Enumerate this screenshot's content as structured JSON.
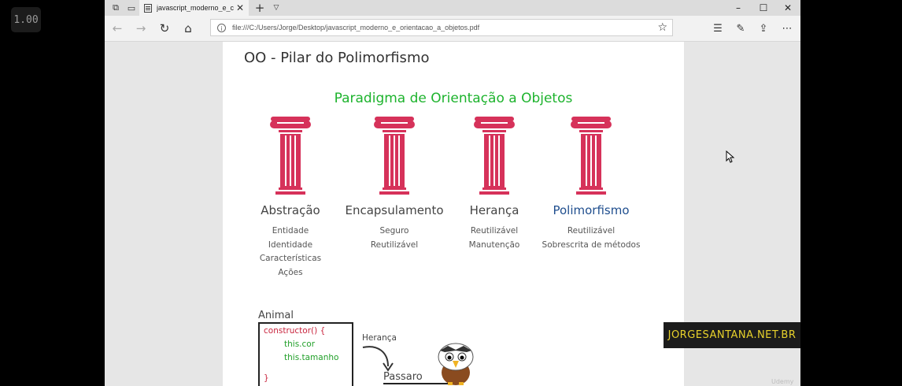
{
  "speed_badge": "1.00",
  "browser": {
    "tab_title": "javascript_moderno_e_c",
    "url": "file:///C:/Users/Jorge/Desktop/javascript_moderno_e_orientacao_a_objetos.pdf"
  },
  "slide": {
    "title": "OO - Pilar do Polimorfismo",
    "subtitle": "Paradigma de Orientação a Objetos",
    "pillars": [
      {
        "label": "Abstração",
        "lines": [
          "Entidade",
          "Identidade",
          "Características",
          "Ações"
        ]
      },
      {
        "label": "Encapsulamento",
        "lines": [
          "Seguro",
          "Reutilizável"
        ]
      },
      {
        "label": "Herança",
        "lines": [
          "Reutilizável",
          "Manutenção"
        ]
      },
      {
        "label": "Polimorfismo",
        "lines": [
          "Reutilizável",
          "Sobrescrita de métodos"
        ]
      }
    ],
    "diagram": {
      "class_name": "Animal",
      "code": [
        "constructor() {",
        "this.cor",
        "this.tamanho",
        "}"
      ],
      "arrow_label": "Herança",
      "subclass_name": "Passaro"
    }
  },
  "watermark": "JORGESANTANA.NET.BR",
  "colors": {
    "pillar": "#d6325a",
    "subtitle": "#1db32d",
    "highlight": "#1f4e8e",
    "watermark": "#e8d22b"
  }
}
